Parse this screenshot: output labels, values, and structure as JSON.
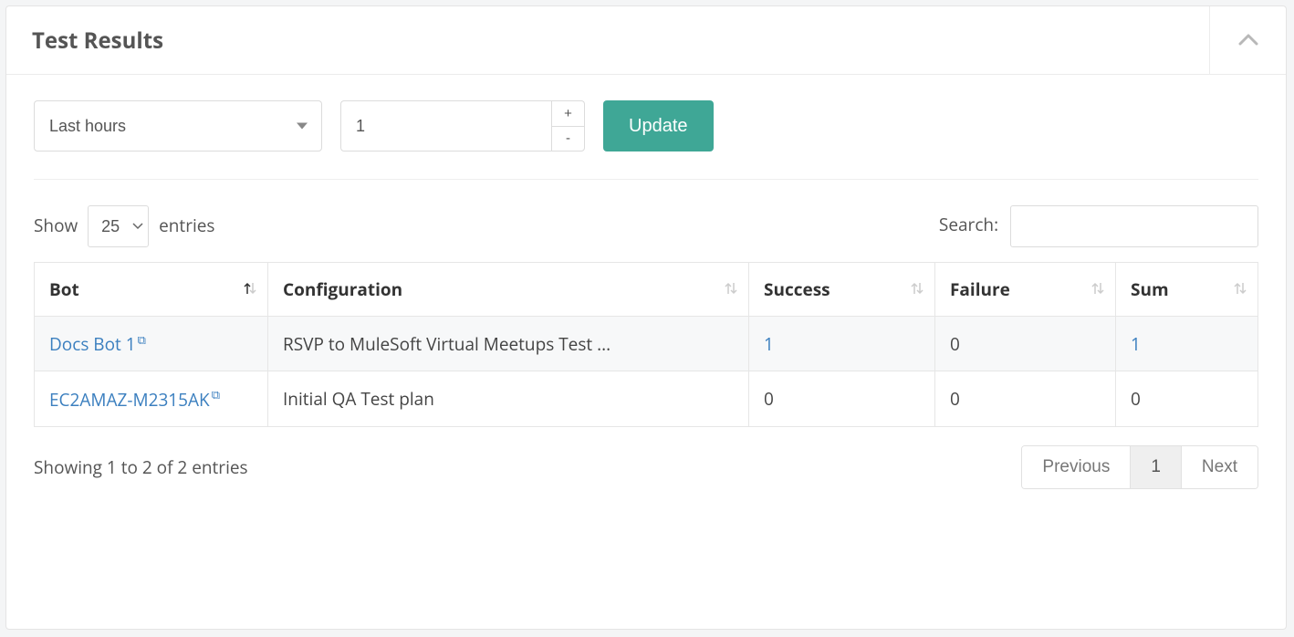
{
  "panel": {
    "title": "Test Results"
  },
  "filter": {
    "range_label": "Last hours",
    "count": "1",
    "update_label": "Update"
  },
  "table_controls": {
    "show_label": "Show",
    "page_size": "25",
    "entries_label": "entries",
    "search_label": "Search:"
  },
  "columns": {
    "bot": "Bot",
    "configuration": "Configuration",
    "success": "Success",
    "failure": "Failure",
    "sum": "Sum"
  },
  "rows": [
    {
      "bot": "Docs Bot 1",
      "configuration": "RSVP to MuleSoft Virtual Meetups Test ...",
      "success": "1",
      "failure": "0",
      "sum": "1",
      "success_link": true,
      "sum_link": true
    },
    {
      "bot": "EC2AMAZ-M2315AK",
      "configuration": "Initial QA Test plan",
      "success": "0",
      "failure": "0",
      "sum": "0",
      "success_link": false,
      "sum_link": false
    }
  ],
  "footer": {
    "info": "Showing 1 to 2 of 2 entries",
    "prev": "Previous",
    "page": "1",
    "next": "Next"
  }
}
